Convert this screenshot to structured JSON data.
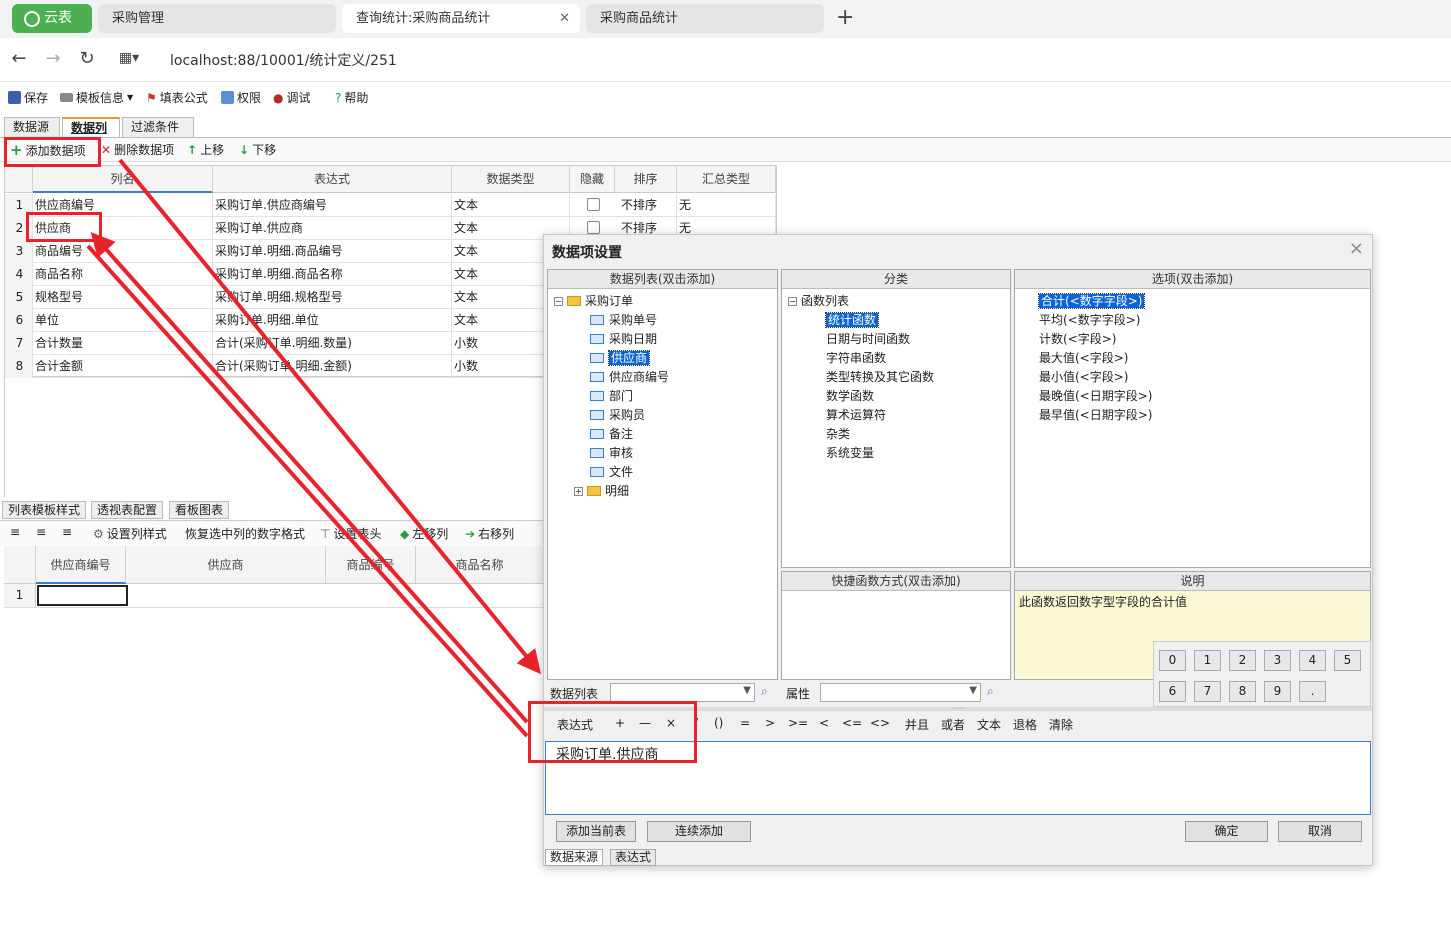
{
  "browser": {
    "logo_tab": "云表",
    "tabs": [
      {
        "label": "采购管理"
      },
      {
        "label": "查询统计:采购商品统计"
      },
      {
        "label": "采购商品统计"
      }
    ],
    "new_tab_label": "+",
    "url": "localhost:88/10001/统计定义/251"
  },
  "app_toolbar": {
    "save": "保存",
    "template_info": "模板信息",
    "fill_formula": "填表公式",
    "permission": "权限",
    "debug": "调试",
    "help": "帮助"
  },
  "design_tabs": [
    "数据源",
    "数据列",
    "过滤条件"
  ],
  "column_toolbar": {
    "add": "添加数据项",
    "delete": "删除数据项",
    "up": "上移",
    "down": "下移"
  },
  "grid": {
    "headers": [
      "列名",
      "表达式",
      "数据类型",
      "隐藏",
      "排序",
      "汇总类型"
    ],
    "rows": [
      {
        "no": "1",
        "name": "供应商编号",
        "expr": "采购订单.供应商编号",
        "type": "文本",
        "sort": "不排序",
        "agg": "无"
      },
      {
        "no": "2",
        "name": "供应商",
        "expr": "采购订单.供应商",
        "type": "文本",
        "sort": "不排序",
        "agg": "无"
      },
      {
        "no": "3",
        "name": "商品编号",
        "expr": "采购订单.明细.商品编号",
        "type": "文本",
        "sort": "",
        "agg": ""
      },
      {
        "no": "4",
        "name": "商品名称",
        "expr": "采购订单.明细.商品名称",
        "type": "文本",
        "sort": "",
        "agg": ""
      },
      {
        "no": "5",
        "name": "规格型号",
        "expr": "采购订单.明细.规格型号",
        "type": "文本",
        "sort": "",
        "agg": ""
      },
      {
        "no": "6",
        "name": "单位",
        "expr": "采购订单.明细.单位",
        "type": "文本",
        "sort": "",
        "agg": ""
      },
      {
        "no": "7",
        "name": "合计数量",
        "expr": "合计(采购订单.明细.数量)",
        "type": "小数",
        "sort": "",
        "agg": ""
      },
      {
        "no": "8",
        "name": "合计金额",
        "expr": "合计(采购订单.明细.金额)",
        "type": "小数",
        "sort": "",
        "agg": ""
      }
    ]
  },
  "bottom_tabs": [
    "列表模板样式",
    "透视表配置",
    "看板图表"
  ],
  "format_toolbar": {
    "set_col_style": "设置列样式",
    "restore_num_fmt": "恢复选中列的数字格式",
    "set_header": "设置表头",
    "move_left": "左移列",
    "move_right": "右移列"
  },
  "preview_grid": {
    "headers": [
      "供应商编号",
      "供应商",
      "商品编号",
      "商品名称"
    ],
    "row_no": "1"
  },
  "dialog": {
    "title": "数据项设置",
    "close": "×",
    "datalist_header": "数据列表(双击添加)",
    "category_header": "分类",
    "options_header": "选项(双击添加)",
    "quick_header": "快捷函数方式(双击添加)",
    "desc_header": "说明",
    "desc_text": "此函数返回数字型字段的合计值",
    "tree_root": "采购订单",
    "tree_fields": [
      "采购单号",
      "采购日期",
      "供应商",
      "供应商编号",
      "部门",
      "采购员",
      "备注",
      "审核",
      "文件"
    ],
    "tree_detail": "明细",
    "cat_root": "函数列表",
    "categories": [
      "统计函数",
      "日期与时间函数",
      "字符串函数",
      "类型转换及其它函数",
      "数学函数",
      "算术运算符",
      "杂类",
      "系统变量"
    ],
    "options": [
      "合计(<数字字段>)",
      "平均(<数字字段>)",
      "计数(<字段>)",
      "最大值(<字段>)",
      "最小值(<字段>)",
      "最晚值(<日期字段>)",
      "最早值(<日期字段>)"
    ],
    "keypad": [
      "0",
      "1",
      "2",
      "3",
      "4",
      "5",
      "6",
      "7",
      "8",
      "9",
      "."
    ],
    "datalist_label": "数据列表",
    "attr_label": "属性",
    "ops": [
      "表达式",
      "+",
      "—",
      "×",
      "/",
      "()",
      "=",
      ">",
      ">=",
      "<",
      "<=",
      "<>",
      "并且",
      "或者",
      "文本",
      "退格",
      "清除"
    ],
    "expression": "采购订单.供应商",
    "add_current": "添加当前表",
    "continuous_add": "连续添加",
    "ok": "确定",
    "cancel": "取消",
    "bottom_tabs": [
      "数据来源",
      "表达式"
    ]
  },
  "colors": {
    "annotation": "#e8232b",
    "brand_green": "#4caf50",
    "selection": "#0a64d6"
  }
}
